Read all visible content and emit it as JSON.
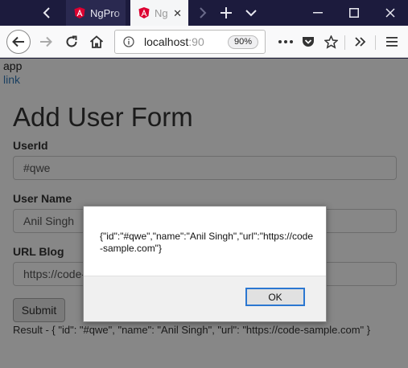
{
  "browser": {
    "tabs": [
      {
        "title": "NgPro",
        "active": false
      },
      {
        "title": "Ng",
        "active": true
      }
    ],
    "address": {
      "host": "localhost",
      "port_fragment": ":90",
      "zoom": "90%"
    }
  },
  "page": {
    "app_text": "app",
    "link_text": "link",
    "form_title": "Add User Form",
    "fields": [
      {
        "label": "UserId",
        "value": "#qwe"
      },
      {
        "label": "User Name",
        "value": "Anil Singh"
      },
      {
        "label": "URL Blog",
        "value": "https://code-s"
      }
    ],
    "submit_label": "Submit",
    "result_text": "Result - { \"id\": \"#qwe\", \"name\": \"Anil Singh\", \"url\": \"https://code-sample.com\" }"
  },
  "dialog": {
    "message": "{\"id\":\"#qwe\",\"name\":\"Anil Singh\",\"url\":\"https://code-sample.com\"}",
    "ok_label": "OK"
  },
  "colors": {
    "titlebar": "#1c1b3d",
    "angular_red": "#dd0031",
    "link_blue": "#337ab7",
    "focus_blue": "#2b77d1"
  },
  "icons": [
    "angular-icon",
    "close-icon",
    "back-arrow-icon",
    "forward-arrow-icon",
    "reload-icon",
    "home-icon",
    "info-icon",
    "more-icon",
    "pocket-icon",
    "star-icon",
    "overflow-icon",
    "menu-icon",
    "minimize-icon",
    "maximize-icon",
    "window-close-icon"
  ]
}
